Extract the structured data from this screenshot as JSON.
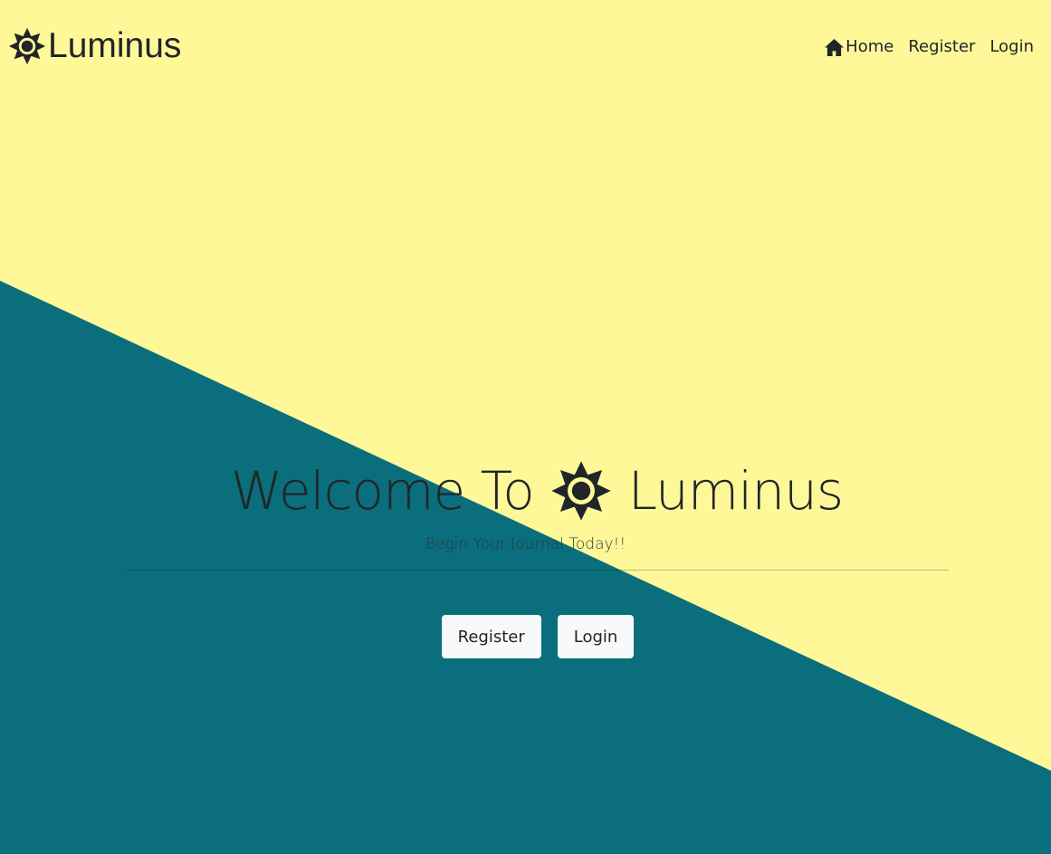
{
  "colors": {
    "background_top": "#fff899",
    "background_bottom": "#0a6e7c",
    "text": "#212529",
    "button_bg": "#f8f9fa"
  },
  "navbar": {
    "brand": {
      "icon": "sun-icon",
      "text": "Luminus"
    },
    "links": [
      {
        "label": "Home",
        "icon": "home-icon"
      },
      {
        "label": "Register"
      },
      {
        "label": "Login"
      }
    ]
  },
  "hero": {
    "title_prefix": "Welcome To",
    "title_icon": "sun-icon",
    "title_suffix": "Luminus",
    "subtitle": "Begin Your Journal Today!!",
    "buttons": [
      {
        "label": "Register"
      },
      {
        "label": "Login"
      }
    ]
  }
}
